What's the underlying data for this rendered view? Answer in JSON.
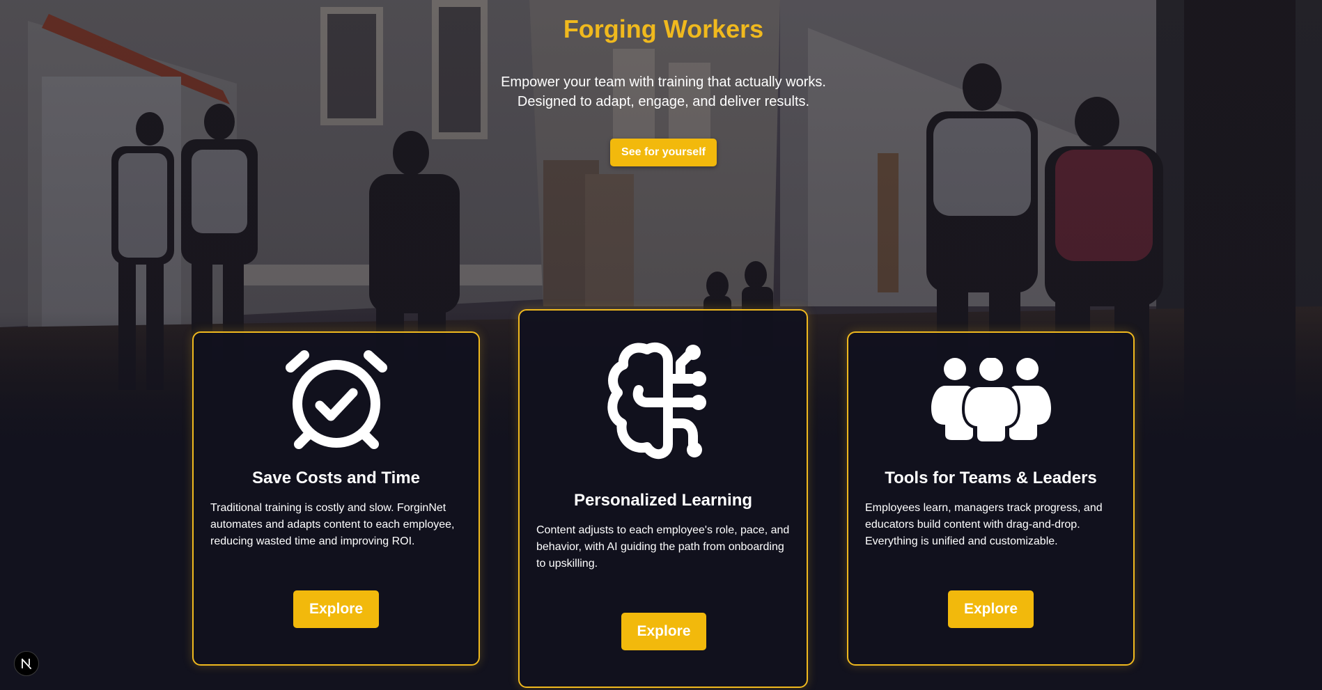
{
  "hero": {
    "title": "Forging Workers",
    "subtitle_line1": "Empower your team with training that actually works.",
    "subtitle_line2": "Designed to adapt, engage, and deliver results.",
    "cta_label": "See for yourself"
  },
  "cards": [
    {
      "icon": "alarm-clock-check-icon",
      "title": "Save Costs and Time",
      "body": "Traditional training is costly and slow. ForginNet automates and adapts content to each employee, reducing wasted time and improving ROI.",
      "button_label": "Explore"
    },
    {
      "icon": "brain-circuit-icon",
      "title": "Personalized Learning",
      "body": "Content adjusts to each employee's role, pace, and behavior, with AI guiding the path from onboarding to upskilling.",
      "button_label": "Explore"
    },
    {
      "icon": "team-users-icon",
      "title": "Tools for Teams & Leaders",
      "body": "Employees learn, managers track progress, and educators build content with drag-and-drop. Everything is unified and customizable.",
      "button_label": "Explore"
    }
  ],
  "dev_badge": {
    "icon": "next-logo-icon",
    "letter": "N"
  },
  "colors": {
    "accent": "#f2b90c",
    "title": "#f0b91e",
    "background": "#12121e",
    "card_border": "#f0b91e"
  }
}
